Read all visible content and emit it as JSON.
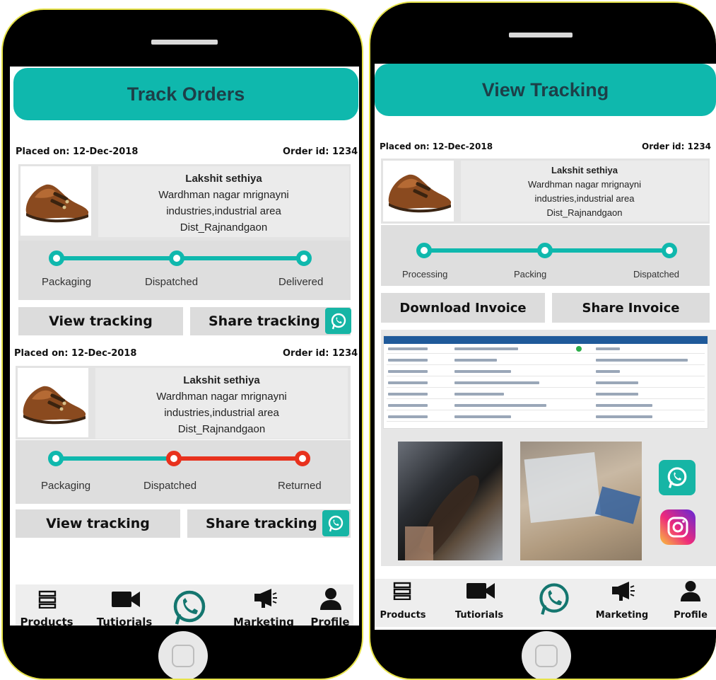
{
  "left_screen": {
    "title": "Track Orders",
    "orders": [
      {
        "placed_on": "Placed on: 12-Dec-2018",
        "order_id": "Order id: 1234",
        "name": "Lakshit sethiya",
        "address_line1": "Wardhman nagar mrignayni",
        "address_line2": "industries,industrial area",
        "address_line3": "Dist_Rajnandgaon",
        "steps": [
          "Packaging",
          "Dispatched",
          "Delivered"
        ],
        "view_label": "View tracking",
        "share_label": "Share tracking"
      },
      {
        "placed_on": "Placed on: 12-Dec-2018",
        "order_id": "Order id: 1234",
        "name": "Lakshit sethiya",
        "address_line1": "Wardhman nagar mrignayni",
        "address_line2": "industries,industrial area",
        "address_line3": "Dist_Rajnandgaon",
        "steps": [
          "Packaging",
          "Dispatched",
          "Returned"
        ],
        "view_label": "View tracking",
        "share_label": "Share tracking"
      }
    ],
    "tabs": [
      "Products",
      "Tutiorials",
      "Marketing",
      "Profile"
    ]
  },
  "right_screen": {
    "title": "View Tracking",
    "placed_on": "Placed on: 12-Dec-2018",
    "order_id": "Order id: 1234",
    "name": "Lakshit sethiya",
    "address_line1": "Wardhman nagar mrignayni",
    "address_line2": "industries,industrial area",
    "address_line3": "Dist_Rajnandgaon",
    "steps": [
      "Processing",
      "Packing",
      "Dispatched"
    ],
    "download_label": "Download Invoice",
    "share_label": "Share Invoice",
    "tabs": [
      "Products",
      "Tutiorials",
      "Marketing",
      "Profile"
    ]
  },
  "colors": {
    "accent": "#0fb8ad",
    "returned": "#e8311d",
    "title_text": "#1d3f48"
  }
}
